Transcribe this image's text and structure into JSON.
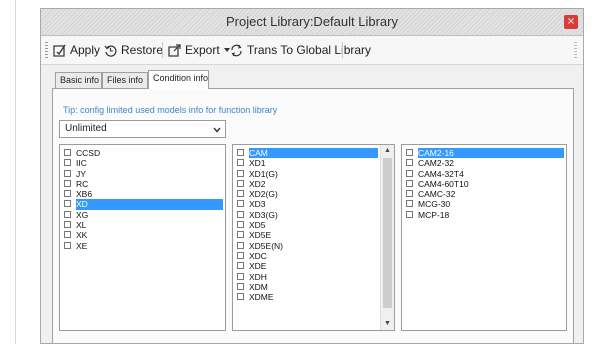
{
  "window": {
    "title": "Project Library:Default Library",
    "close_glyph": "×"
  },
  "toolbar": {
    "apply": "Apply",
    "restore": "Restore",
    "export": "Export",
    "trans": "Trans To Global Library"
  },
  "tabs": [
    {
      "label": "Basic info",
      "active": false
    },
    {
      "label": "Files info",
      "active": false
    },
    {
      "label": "Condition info",
      "active": true
    }
  ],
  "tip": "Tip: config limited used models info for function library",
  "dropdown": {
    "selected": "Unlimited"
  },
  "list_left": {
    "items": [
      "CCSD",
      "IIC",
      "JY",
      "RC",
      "XB6",
      "XD",
      "XG",
      "XL",
      "XK",
      "XE"
    ],
    "selected": "XD"
  },
  "list_middle": {
    "items": [
      "CAM",
      "XD1",
      "XD1(G)",
      "XD2",
      "XD2(G)",
      "XD3",
      "XD3(G)",
      "XD5",
      "XD5E",
      "XD5E(N)",
      "XDC",
      "XDE",
      "XDH",
      "XDM",
      "XDME"
    ],
    "selected": "CAM"
  },
  "list_right": {
    "items": [
      "CAM2-16",
      "CAM2-32",
      "CAM4-32T4",
      "CAM4-60T10",
      "CAMC-32",
      "MCG-30",
      "MCP-18"
    ],
    "selected": "CAM2-16"
  },
  "colors": {
    "selection": "#3399ff",
    "tip": "#3f86c9",
    "close": "#d93b3b"
  }
}
